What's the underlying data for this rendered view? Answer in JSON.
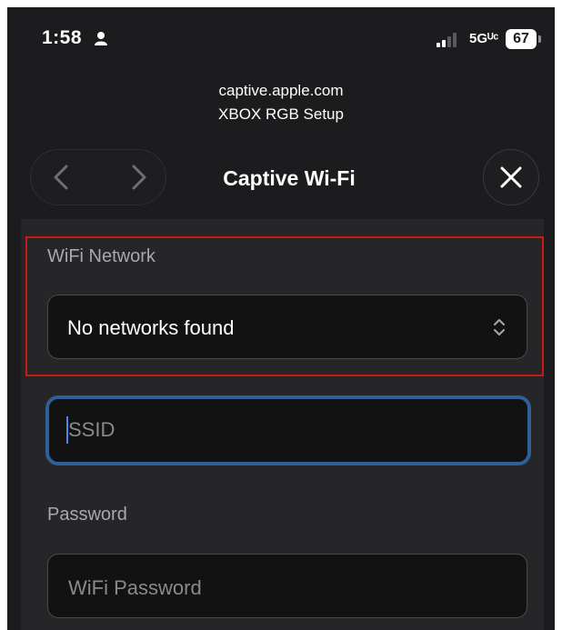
{
  "status_bar": {
    "time": "1:58",
    "network_type": "5Gᵁᶜ",
    "battery_level": "67"
  },
  "header": {
    "domain": "captive.apple.com",
    "page_title": "XBOX RGB Setup",
    "sheet_title": "Captive Wi-Fi"
  },
  "form": {
    "wifi_label": "WiFi Network",
    "wifi_selected": "No networks found",
    "ssid_placeholder": "SSID",
    "password_label": "Password",
    "password_placeholder": "WiFi Password"
  },
  "icons": [
    "person-icon",
    "signal-icon",
    "back-chevron-icon",
    "forward-chevron-icon",
    "close-icon",
    "updown-chevron-icon"
  ],
  "colors": {
    "background": "#1c1c1e",
    "content": "#262628",
    "highlight": "#d01818",
    "focus_border": "#2f5e98"
  }
}
